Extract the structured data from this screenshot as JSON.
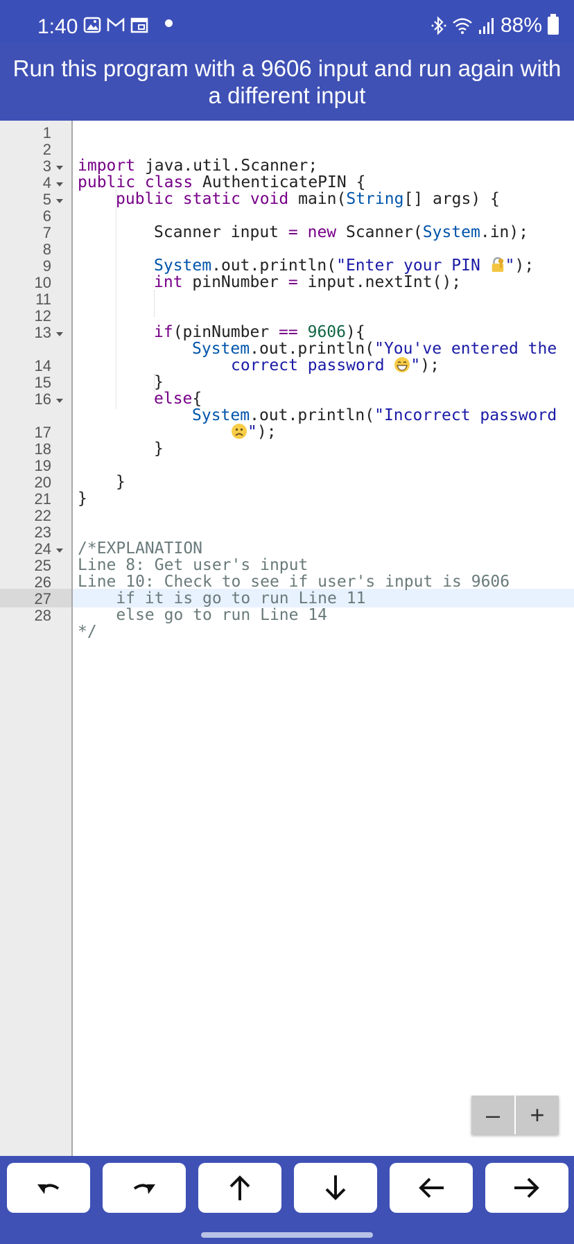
{
  "status_bar": {
    "time": "1:40",
    "battery": "88%",
    "icons": [
      "gallery-icon",
      "gmail-icon",
      "calendar-icon",
      "bluetooth-icon",
      "wifi-icon",
      "signal-icon",
      "battery-icon"
    ]
  },
  "header": {
    "title": "Run this program with a 9606 input and run again with a different input"
  },
  "editor": {
    "line_numbers": [
      "1",
      "2",
      "3",
      "4",
      "5",
      "6",
      "7",
      "8",
      "9",
      "10",
      "11",
      "12",
      "13",
      "14",
      "15",
      "16",
      "17",
      "18",
      "19",
      "20",
      "21",
      "22",
      "23",
      "24",
      "25",
      "26",
      "27",
      "28"
    ],
    "active_line": "28",
    "code": {
      "l3_a": "import",
      "l3_b": " java.util.Scanner;",
      "l4_a": "public class",
      "l4_b": " AuthenticatePIN {",
      "l5_a": "public static void",
      "l5_b": " main(",
      "l5_c": "String",
      "l5_d": "[] args) {",
      "l7_a": "Scanner input ",
      "l7_b": "=",
      "l7_c": " ",
      "l7_d": "new",
      "l7_e": " Scanner(",
      "l7_f": "System",
      "l7_g": ".in);",
      "l9_a": "System",
      "l9_b": ".out.println(",
      "l9_c": "\"Enter your PIN ",
      "l9_d": "\"",
      "l9_e": ");",
      "l10_a": "int",
      "l10_b": " pinNumber ",
      "l10_c": "=",
      "l10_d": " input.nextInt();",
      "l12_a": "if",
      "l12_b": "(pinNumber ",
      "l12_c": "==",
      "l12_d": " ",
      "l12_e": "9606",
      "l12_f": "){",
      "l13_a": "System",
      "l13_b": ".out.println(",
      "l13_c": "\"You've entered the",
      "l13w_a": "correct password ",
      "l13w_b": "\"",
      "l13w_c": ");",
      "l14": "}",
      "l15_a": "else",
      "l15_b": "{",
      "l16_a": "System",
      "l16_b": ".out.println(",
      "l16_c": "\"Incorrect password",
      "l16w_b": "\"",
      "l16w_c": ");",
      "l17": "}",
      "l19": "}",
      "l20": "}",
      "l23": "/*EXPLANATION",
      "l24": "Line 8: Get user's input",
      "l25": "Line 10: Check to see if user's input is 9606",
      "l26": "    if it is go to run Line 11",
      "l27": "    else go to run Line 14",
      "l28": "*/"
    }
  },
  "zoom": {
    "minus": "–",
    "plus": "+"
  },
  "toolbar": {
    "buttons": [
      "undo",
      "redo",
      "move-line-up",
      "move-line-down",
      "cursor-left",
      "cursor-right"
    ]
  }
}
